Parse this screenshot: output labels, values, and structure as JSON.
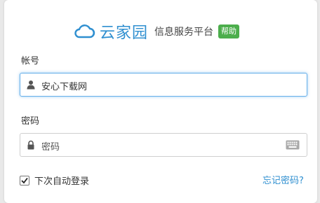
{
  "brand": {
    "name": "云家园",
    "subtitle": "信息服务平台",
    "help_badge": "帮助",
    "logo_icon": "cloud-icon",
    "brand_color": "#2f8fd0",
    "badge_color": "#4cae4c"
  },
  "account": {
    "label": "帐号",
    "value": "安心下载网",
    "icon": "user-icon"
  },
  "password": {
    "label": "密码",
    "placeholder": "密码",
    "icon": "lock-icon",
    "keyboard_icon": "keyboard-icon"
  },
  "remember": {
    "label": "下次自动登录",
    "checked": true
  },
  "forgot_link": "忘记密码?"
}
